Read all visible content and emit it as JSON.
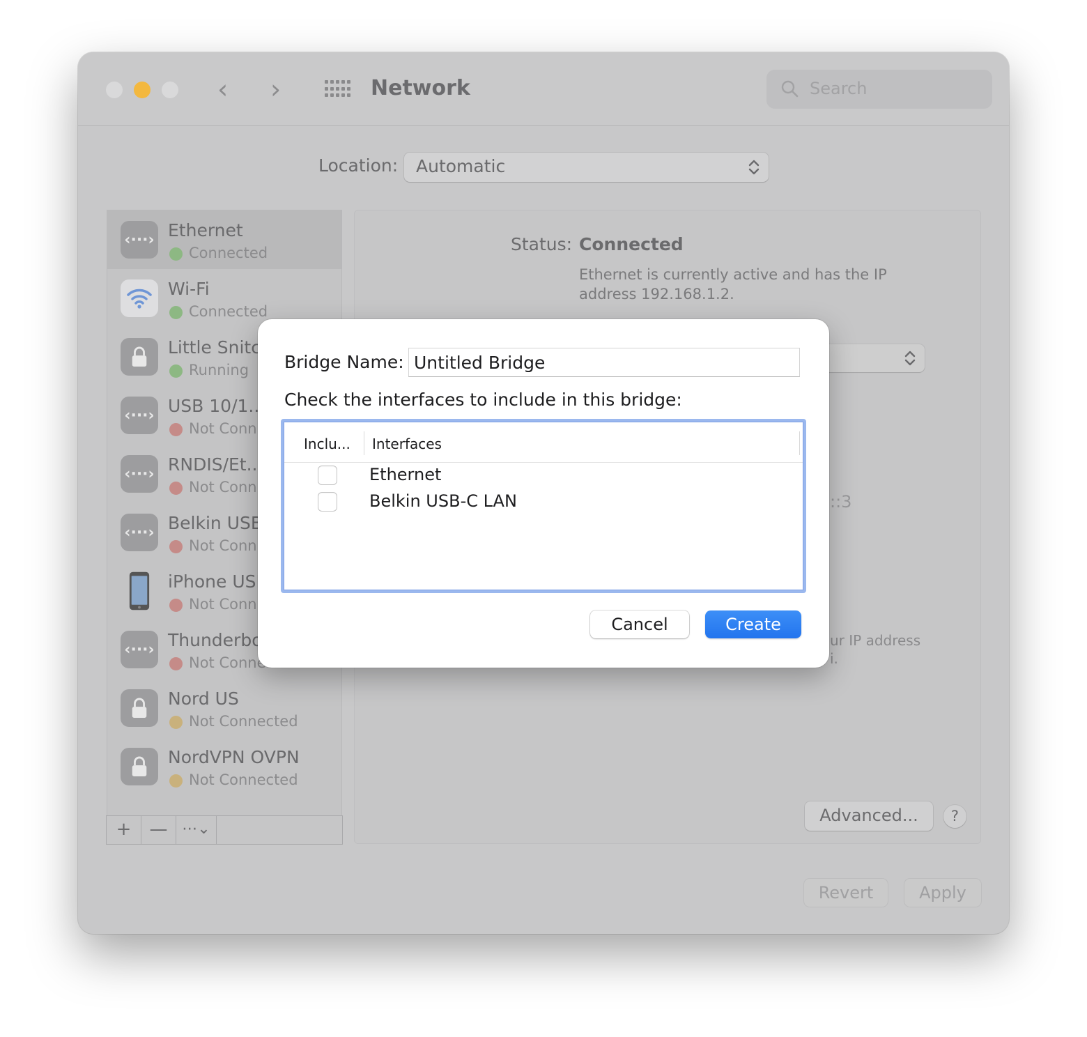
{
  "window": {
    "title": "Network",
    "search_placeholder": "Search"
  },
  "location": {
    "label": "Location:",
    "value": "Automatic"
  },
  "services": [
    {
      "name": "Ethernet",
      "status": "Connected",
      "status_color": "green",
      "icon": "ethernet-icon"
    },
    {
      "name": "Wi-Fi",
      "status": "Connected",
      "status_color": "green",
      "icon": "wifi-icon"
    },
    {
      "name": "Little Snitc",
      "status": "Running",
      "status_color": "green",
      "icon": "lock-icon"
    },
    {
      "name": "USB 10/1...",
      "status": "Not Conn",
      "status_color": "red",
      "icon": "ethernet-icon"
    },
    {
      "name": "RNDIS/Et...",
      "status": "Not Conn",
      "status_color": "red",
      "icon": "ethernet-icon"
    },
    {
      "name": "Belkin USB",
      "status": "Not Conn",
      "status_color": "red",
      "icon": "ethernet-icon"
    },
    {
      "name": "iPhone USI",
      "status": "Not Conn",
      "status_color": "red",
      "icon": "iphone-icon"
    },
    {
      "name": "Thunderbo",
      "status": "Not Conne",
      "status_color": "red",
      "icon": "ethernet-icon"
    },
    {
      "name": "Nord US",
      "status": "Not Connected",
      "status_color": "yellow",
      "icon": "lock-icon"
    },
    {
      "name": "NordVPN OVPN",
      "status": "Not Connected",
      "status_color": "yellow",
      "icon": "lock-icon"
    }
  ],
  "sidebar_tools": {
    "add": "+",
    "remove": "—",
    "action": "⋯⌄"
  },
  "detail": {
    "status_label": "Status:",
    "status_value": "Connected",
    "status_description": "Ethernet is currently active and has the IP address 192.168.1.2.",
    "ipv6_fragment": "::3",
    "note_fragment_1": "ur IP address",
    "note_fragment_2": "i.",
    "advanced_button": "Advanced...",
    "help_button": "?"
  },
  "footer": {
    "revert": "Revert",
    "apply": "Apply"
  },
  "sheet": {
    "bridge_name_label": "Bridge Name:",
    "bridge_name_value": "Untitled Bridge",
    "instructions": "Check the interfaces to include in this bridge:",
    "columns": [
      "Inclu...",
      "Interfaces"
    ],
    "interfaces": [
      {
        "name": "Ethernet",
        "included": false
      },
      {
        "name": "Belkin USB-C LAN",
        "included": false
      }
    ],
    "cancel": "Cancel",
    "create": "Create"
  },
  "colors": {
    "accent": "#2a7cf2",
    "green": "#8db883",
    "red": "#c58b88",
    "yellow": "#c9b17c"
  }
}
